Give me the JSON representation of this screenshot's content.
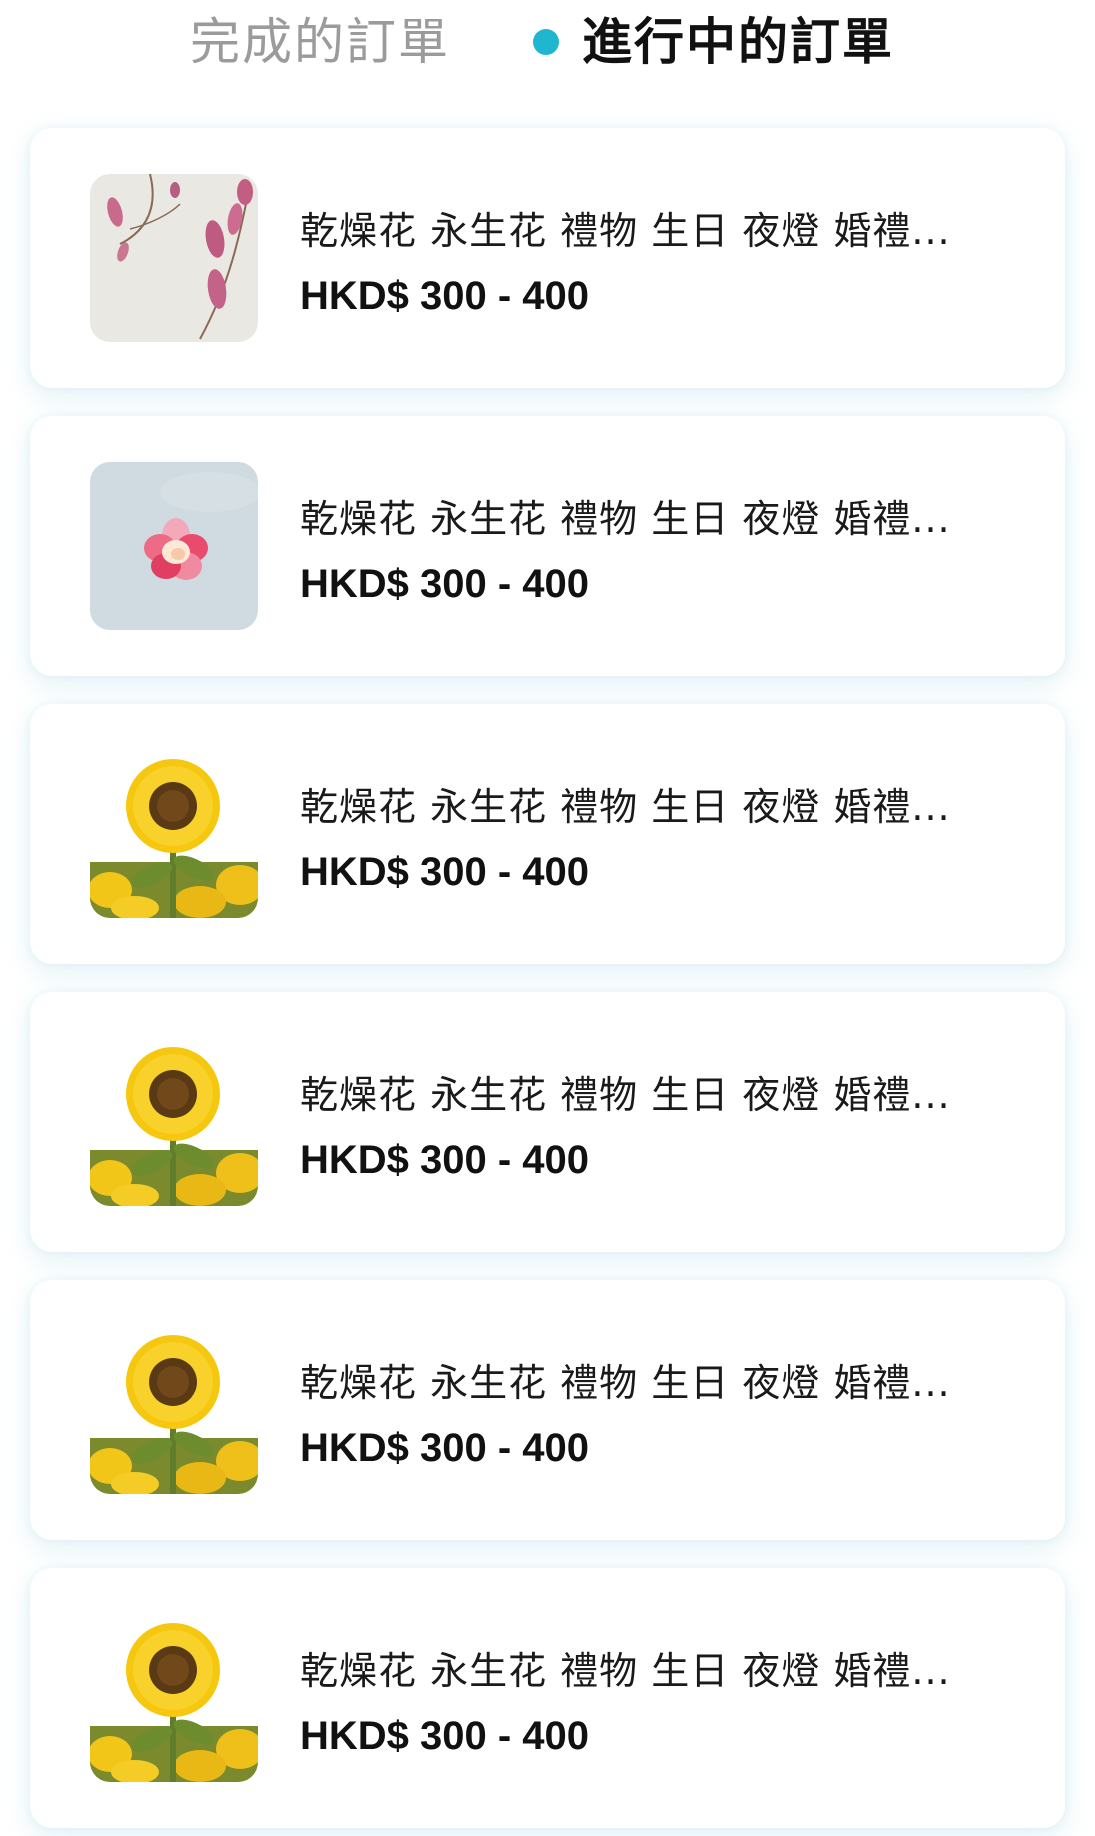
{
  "tabs": {
    "completed_label": "完成的訂單",
    "active_label": "進行中的訂單",
    "active_indicator_color": "#1fb7cf"
  },
  "orders": [
    {
      "title": "乾燥花 永生花 禮物 生日 夜燈 婚禮...",
      "price": "HKD$ 300 - 400",
      "image": "magnolia-branch-image"
    },
    {
      "title": "乾燥花 永生花 禮物 生日 夜燈 婚禮...",
      "price": "HKD$ 300 - 400",
      "image": "pink-flower-image"
    },
    {
      "title": "乾燥花 永生花 禮物 生日 夜燈 婚禮...",
      "price": "HKD$ 300 - 400",
      "image": "sunflower-image"
    },
    {
      "title": "乾燥花 永生花 禮物 生日 夜燈 婚禮...",
      "price": "HKD$ 300 - 400",
      "image": "sunflower-image"
    },
    {
      "title": "乾燥花 永生花 禮物 生日 夜燈 婚禮...",
      "price": "HKD$ 300 - 400",
      "image": "sunflower-image"
    },
    {
      "title": "乾燥花 永生花 禮物 生日 夜燈 婚禮...",
      "price": "HKD$ 300 - 400",
      "image": "sunflower-image"
    }
  ]
}
